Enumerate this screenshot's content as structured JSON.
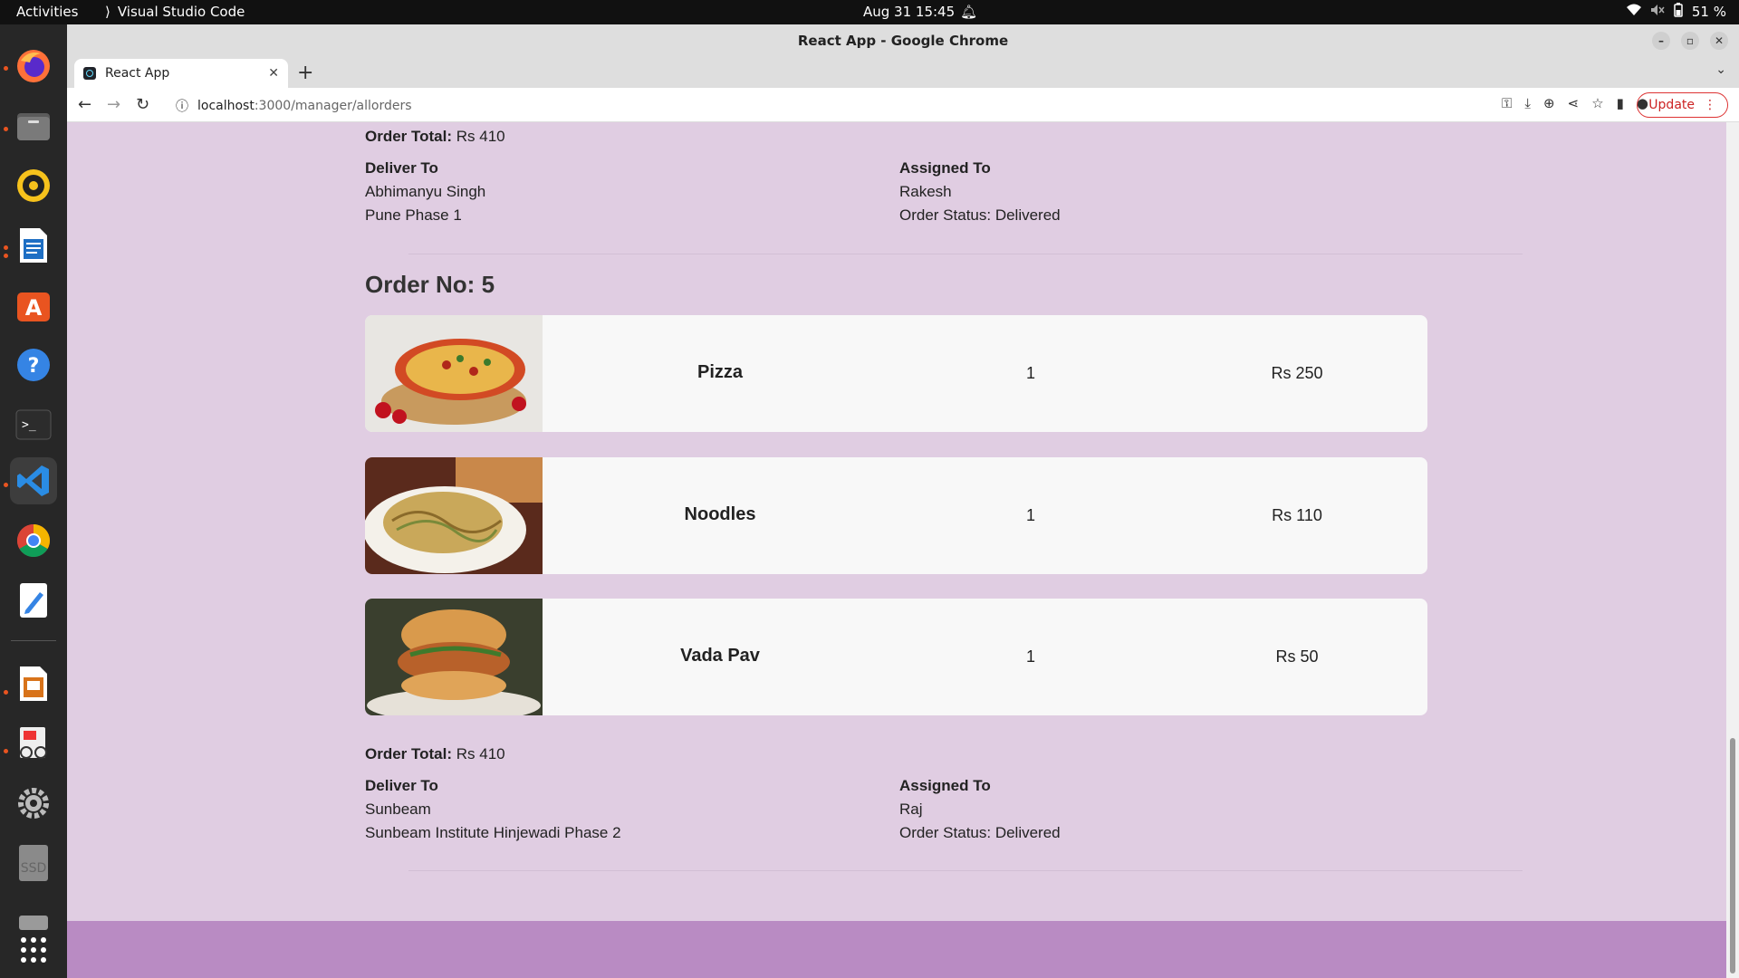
{
  "topbar": {
    "activities": "Activities",
    "app": "Visual Studio Code",
    "datetime": "Aug 31  15:45",
    "battery": "51 %"
  },
  "dock": {
    "items": [
      "firefox-icon",
      "files-icon",
      "rhythmbox-icon",
      "writer-icon",
      "software-icon",
      "help-icon",
      "terminal-icon",
      "vscode-icon",
      "chrome-icon",
      "text-editor-icon",
      "impress-icon",
      "document-viewer-icon",
      "settings-icon",
      "ssd-icon",
      "drive-icon",
      "app-grid-icon"
    ]
  },
  "window": {
    "title": "React App - Google Chrome",
    "tab_title": "React App",
    "url_host": "localhost",
    "url_path": ":3000/manager/allorders",
    "update_label": "Update"
  },
  "previous_order": {
    "total_label": "Order Total:",
    "total_value": "Rs 410",
    "deliver_to_label": "Deliver To",
    "customer_name": "Abhimanyu Singh",
    "address": "Pune Phase 1",
    "assigned_to_label": "Assigned To",
    "assignee": "Rakesh",
    "status": "Order Status: Delivered"
  },
  "order": {
    "title": "Order No: 5",
    "items": [
      {
        "name": "Pizza",
        "qty": "1",
        "price": "Rs 250"
      },
      {
        "name": "Noodles",
        "qty": "1",
        "price": "Rs 110"
      },
      {
        "name": "Vada Pav",
        "qty": "1",
        "price": "Rs 50"
      }
    ],
    "total_label": "Order Total:",
    "total_value": "Rs 410",
    "deliver_to_label": "Deliver To",
    "customer_name": "Sunbeam",
    "address": "Sunbeam Institute Hinjewadi Phase 2",
    "assigned_to_label": "Assigned To",
    "assignee": "Raj",
    "status": "Order Status: Delivered"
  }
}
